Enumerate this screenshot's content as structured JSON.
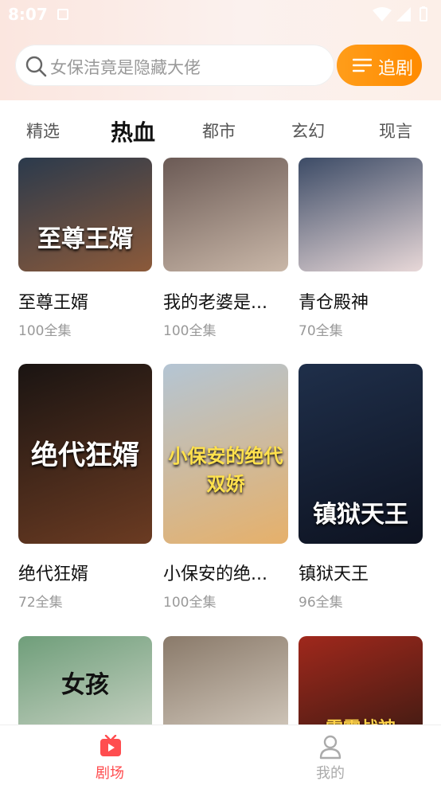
{
  "status": {
    "time": "8:07"
  },
  "search": {
    "placeholder": "女保洁竟是隐藏大佬"
  },
  "follow_button": {
    "label": "追剧"
  },
  "tabs": [
    {
      "label": "精选",
      "active": false
    },
    {
      "label": "热血",
      "active": true
    },
    {
      "label": "都市",
      "active": false
    },
    {
      "label": "玄幻",
      "active": false
    },
    {
      "label": "现言",
      "active": false
    }
  ],
  "dramas": [
    {
      "title": "至尊王婿",
      "episodes": "100全集",
      "poster_text": "至尊王婿",
      "colors": [
        "#2b3a4c",
        "#8c5a3a"
      ]
    },
    {
      "title": "我的老婆是...",
      "episodes": "100全集",
      "poster_text": "",
      "colors": [
        "#6b5a55",
        "#c9b7a8"
      ]
    },
    {
      "title": "青仓殿神",
      "episodes": "70全集",
      "poster_text": "",
      "colors": [
        "#3c4b66",
        "#e8d8d8"
      ]
    },
    {
      "title": "绝代狂婿",
      "episodes": "72全集",
      "poster_text": "绝代狂婿",
      "colors": [
        "#1a1412",
        "#6b3b22"
      ]
    },
    {
      "title": "小保安的绝...",
      "episodes": "100全集",
      "poster_text": "小保安的绝代双娇",
      "colors": [
        "#b4c5d4",
        "#e6b06a"
      ]
    },
    {
      "title": "镇狱天王",
      "episodes": "96全集",
      "poster_text": "镇狱天王",
      "colors": [
        "#1f2f4a",
        "#0d1220"
      ]
    },
    {
      "title": "",
      "episodes": "",
      "poster_text": "女孩",
      "colors": [
        "#6f9e7a",
        "#cfd6c9"
      ]
    },
    {
      "title": "",
      "episodes": "",
      "poster_text": "",
      "colors": [
        "#8a7a6a",
        "#d8cfc3"
      ]
    },
    {
      "title": "",
      "episodes": "",
      "poster_text": "雷霆战神",
      "colors": [
        "#a0281c",
        "#3a1a12"
      ]
    }
  ],
  "bottom_nav": [
    {
      "label": "剧场",
      "active": true
    },
    {
      "label": "我的",
      "active": false
    }
  ],
  "colors": {
    "accent": "#ff8f0f",
    "nav_active": "#ff4d4f",
    "nav_inactive": "#aaaaaa"
  }
}
